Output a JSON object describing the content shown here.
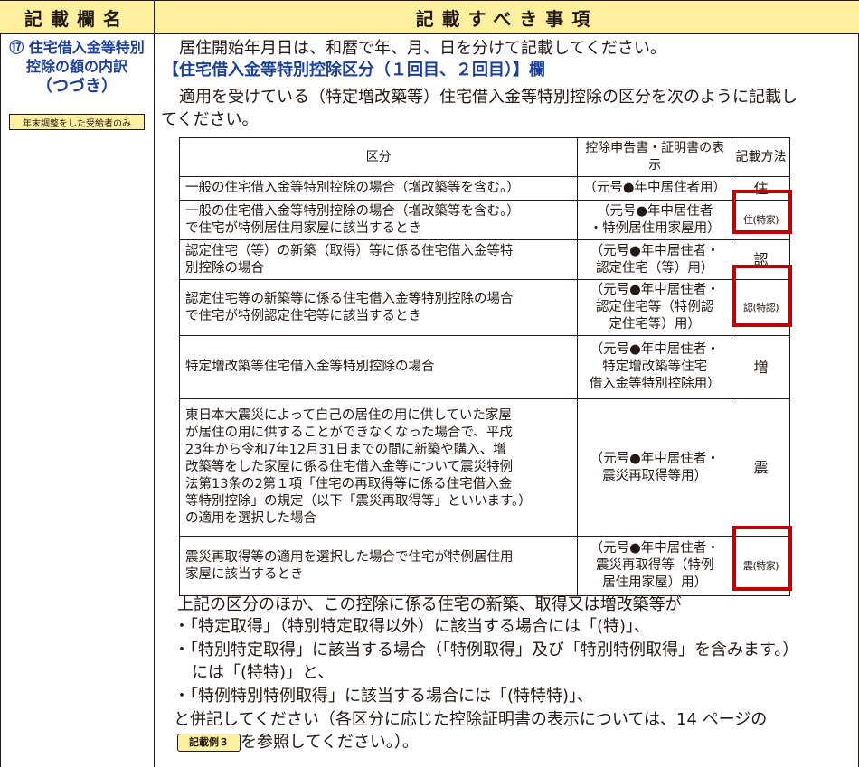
{
  "header": {
    "left": "記載欄名",
    "right": "記載すべき事項"
  },
  "left": {
    "line1": "⑰ 住宅借入金等特別",
    "line2": "控除の額の内訳",
    "line3": "（つづき）",
    "badge": "年末調整をした受給者のみ"
  },
  "intro": {
    "p1": "居住開始年月日は、和暦で年、月、日を分けて記載してください。",
    "heading": "【住宅借入金等特別控除区分（１回目、２回目）】欄",
    "p2a": "適用を受けている（特定増改築等）住宅借入金等特別控除の区分を次のように記載し",
    "p2b": "てください。"
  },
  "table": {
    "headers": {
      "kubun": "区分",
      "hyouji": "控除申告書・証明書の表示",
      "houhou": "記載方法"
    },
    "rows": [
      {
        "kubun": [
          "一般の住宅借入金等特別控除の場合（増改築等を含む。）"
        ],
        "hyouji": [
          "（元号●年中居住者用）"
        ],
        "houhou": "住"
      },
      {
        "kubun": [
          "一般の住宅借入金等特別控除の場合（増改築等を含む。）",
          "で住宅が特例居住用家屋に該当するとき"
        ],
        "hyouji": [
          "（元号●年中居住者",
          "・特例居住用家屋用）"
        ],
        "houhou": "住(特家)"
      },
      {
        "kubun": [
          "認定住宅（等）の新築（取得）等に係る住宅借入金等特",
          "別控除の場合"
        ],
        "hyouji": [
          "（元号●年中居住者・",
          "認定住宅（等）用）"
        ],
        "houhou": "認"
      },
      {
        "kubun": [
          "認定住宅等の新築等に係る住宅借入金等特別控除の場合",
          "で住宅が特例認定住宅等に該当するとき"
        ],
        "hyouji": [
          "（元号●年中居住者・",
          "認定住宅等（特例認",
          "定住宅等）用）"
        ],
        "houhou": "認(特認)"
      },
      {
        "kubun": [
          "特定増改築等住宅借入金等特別控除の場合"
        ],
        "hyouji": [
          "（元号●年中居住者・",
          "特定増改築等住宅",
          "借入金等特別控除用）"
        ],
        "houhou": "増"
      },
      {
        "kubun": [
          "東日本大震災によって自己の居住の用に供していた家屋",
          "が居住の用に供することができなくなった場合で、平成",
          "23年から令和7年12月31日までの間に新築や購入、増",
          "改築等をした家屋に係る住宅借入金等について震災特例",
          "法第13条の2第１項「住宅の再取得等に係る住宅借入金",
          "等特別控除」の規定（以下「震災再取得等」といいます。）",
          "の適用を選択した場合"
        ],
        "hyouji": [
          "（元号●年中居住者・",
          "震災再取得等用）"
        ],
        "houhou": "震"
      },
      {
        "kubun": [
          "震災再取得等の適用を選択した場合で住宅が特例居住用",
          "家屋に該当するとき"
        ],
        "hyouji": [
          "（元号●年中居住者・",
          "震災再取得等（特例",
          "居住用家屋）用）"
        ],
        "houhou": "震(特家)"
      }
    ]
  },
  "after": {
    "p1": "上記の区分のほか、この控除に係る住宅の新築、取得又は増改築等が",
    "b1": "・「特定取得」（特別特定取得以外）に該当する場合には「(特)」、",
    "b2a": "・「特別特定取得」に該当する場合（「特例取得」及び「特別特例取得」を含みます。）",
    "b2b": "には「(特特)」と、",
    "b3": "・「特例特別特例取得」に該当する場合には「(特特特)」、",
    "p2": "と併記してください（各区分に応じた控除証明書の表示については、14 ページの",
    "marker": "記載例３",
    "p3": "を参照してください。）。"
  },
  "colors": {
    "header_bg": "#fff0a0",
    "blue": "#1a3f9c",
    "red_box": "#c00000"
  }
}
